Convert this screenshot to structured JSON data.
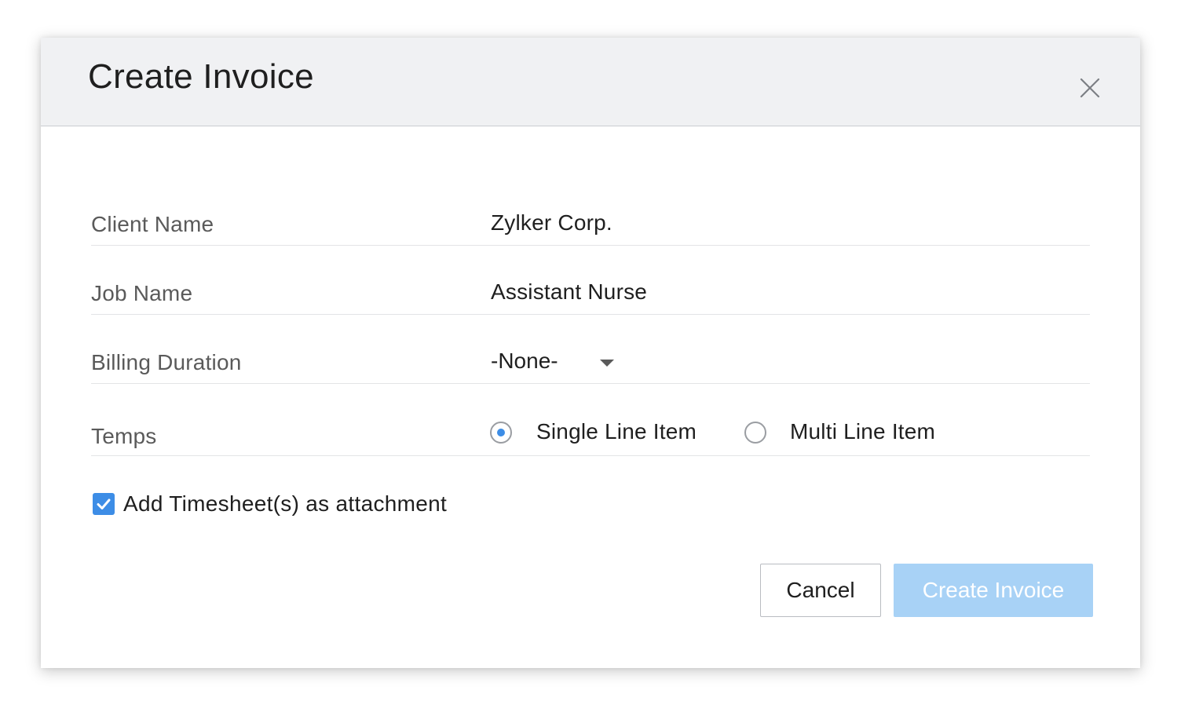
{
  "dialog": {
    "title": "Create Invoice"
  },
  "form": {
    "client_name": {
      "label": "Client Name",
      "value": "Zylker Corp."
    },
    "job_name": {
      "label": "Job Name",
      "value": "Assistant Nurse"
    },
    "billing_duration": {
      "label": "Billing Duration",
      "selected": "-None-"
    },
    "temps": {
      "label": "Temps",
      "options": [
        {
          "label": "Single Line Item",
          "checked": true
        },
        {
          "label": "Multi Line Item",
          "checked": false
        }
      ]
    },
    "attach_timesheets": {
      "label": "Add Timesheet(s) as attachment",
      "checked": true
    }
  },
  "actions": {
    "cancel_label": "Cancel",
    "create_label": "Create Invoice"
  },
  "colors": {
    "accent": "#3d8de6",
    "primary_button_disabled": "#a8d2f6",
    "header_bg": "#f0f1f3"
  },
  "icons": {
    "close": "close-icon",
    "dropdown": "caret-down-icon",
    "check": "checkmark-icon"
  }
}
